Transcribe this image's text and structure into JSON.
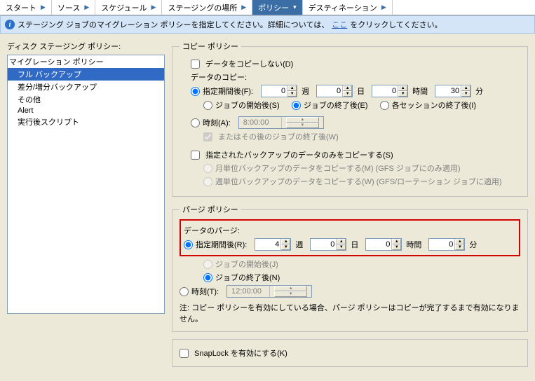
{
  "tabs": {
    "start": "スタート",
    "source": "ソース",
    "schedule": "スケジュール",
    "staging": "ステージングの場所",
    "policy": "ポリシー",
    "destination": "デスティネーション"
  },
  "info_bar": {
    "pre": "ステージング ジョブのマイグレーション ポリシーを指定してください。詳細については、",
    "link": "ここ",
    "post": " をクリックしてください。"
  },
  "left": {
    "title": "ディスク ステージング ポリシー:",
    "items": {
      "migration": "マイグレーション ポリシー",
      "full": "フル バックアップ",
      "diff": "差分/増分バックアップ",
      "other": "その他",
      "alert": "Alert",
      "postscript": "実行後スクリプト"
    }
  },
  "copy": {
    "legend": "コピー ポリシー",
    "no_copy": "データをコピーしない(D)",
    "data_copy_label": "データのコピー:",
    "period_after": "指定期間後(F):",
    "values": {
      "weeks": "0",
      "days": "0",
      "hours": "0",
      "mins": "30"
    },
    "units": {
      "weeks": "週",
      "days": "日",
      "hours": "時間",
      "mins": "分"
    },
    "job_start": "ジョブの開始後(S)",
    "job_end": "ジョブの終了後(E)",
    "session_end": "各セッションの終了後(I)",
    "at_time": "時刻(A):",
    "time_value": "8:00:00",
    "or_after": "またはその後のジョブの終了後(W)",
    "only_specified": "指定されたバックアップのデータのみをコピーする(S)",
    "monthly": "月単位バックアップのデータをコピーする(M) (GFS ジョブにのみ適用)",
    "weekly": "週単位バックアップのデータをコピーする(W) (GFS/ローテーション ジョブに適用)"
  },
  "purge": {
    "legend": "パージ ポリシー",
    "data_purge_label": "データのパージ:",
    "period_after": "指定期間後(R):",
    "values": {
      "weeks": "4",
      "days": "0",
      "hours": "0",
      "mins": "0"
    },
    "units": {
      "weeks": "週",
      "days": "日",
      "hours": "時間",
      "mins": "分"
    },
    "job_start": "ジョブの開始後(J)",
    "job_end": "ジョブの終了後(N)",
    "at_time": "時刻(T):",
    "time_value": "12:00:00",
    "note": "注: コピー ポリシーを有効にしている場合、パージ ポリシーはコピーが完了するまで有効になりません。"
  },
  "snaplock": {
    "label": "SnapLock を有効にする(K)"
  }
}
